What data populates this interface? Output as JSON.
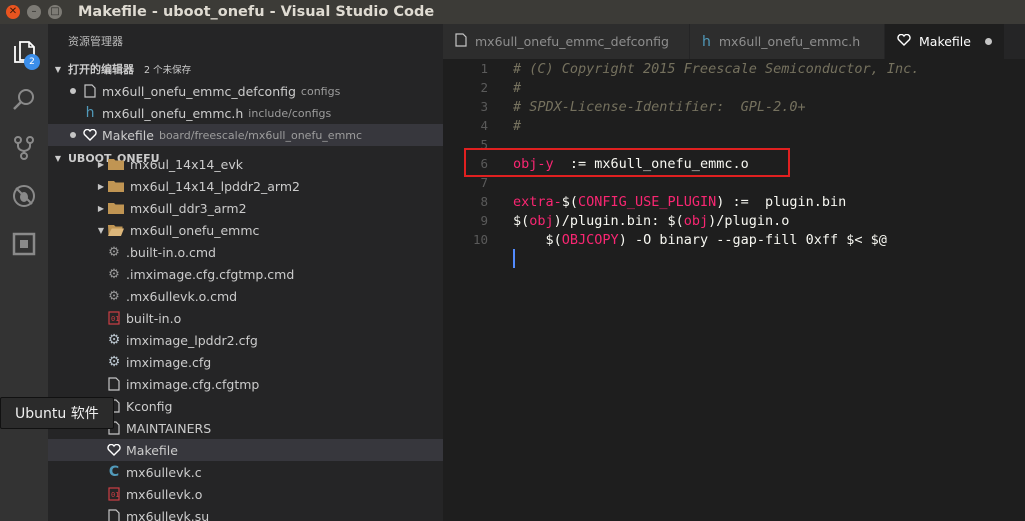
{
  "window": {
    "title": "Makefile - uboot_onefu - Visual Studio Code"
  },
  "activity_bar": {
    "explorer_badge": "2"
  },
  "sidebar": {
    "header": "资源管理器",
    "open_editors": {
      "title": "打开的编辑器",
      "count": "2 个未保存",
      "items": [
        {
          "name": "mx6ull_onefu_emmc_defconfig",
          "desc": "configs"
        },
        {
          "name": "mx6ull_onefu_emmc.h",
          "desc": "include/configs"
        },
        {
          "name": "Makefile",
          "desc": "board/freescale/mx6ull_onefu_emmc"
        }
      ]
    },
    "project": {
      "title": "UBOOT_ONEFU"
    },
    "tree": [
      {
        "label": "mx6ul_14x14_evk"
      },
      {
        "label": "mx6ul_14x14_lpddr2_arm2"
      },
      {
        "label": "mx6ull_ddr3_arm2"
      },
      {
        "label": "mx6ull_onefu_emmc"
      },
      {
        "label": ".built-in.o.cmd"
      },
      {
        "label": ".imximage.cfg.cfgtmp.cmd"
      },
      {
        "label": ".mx6ullevk.o.cmd"
      },
      {
        "label": "built-in.o"
      },
      {
        "label": "imximage_lpddr2.cfg"
      },
      {
        "label": "imximage.cfg"
      },
      {
        "label": "imximage.cfg.cfgtmp"
      },
      {
        "label": "Kconfig"
      },
      {
        "label": "MAINTAINERS"
      },
      {
        "label": "Makefile"
      },
      {
        "label": "mx6ullevk.c"
      },
      {
        "label": "mx6ullevk.o"
      },
      {
        "label": "mx6ullevk.su"
      }
    ]
  },
  "tooltip": "Ubuntu 软件",
  "tabs": [
    {
      "label": "mx6ull_onefu_emmc_defconfig"
    },
    {
      "label": "mx6ull_onefu_emmc.h"
    },
    {
      "label": "Makefile"
    }
  ],
  "code": {
    "line_numbers": [
      "1",
      "2",
      "3",
      "4",
      "5",
      "6",
      "7",
      "8",
      "9",
      "10"
    ],
    "l1": "# (C) Copyright 2015 Freescale Semiconductor, Inc.",
    "l2": "#",
    "l3": "# SPDX-License-Identifier:  GPL-2.0+",
    "l4": "#",
    "l6a": "obj-y",
    "l6b": "  := mx6ull_onefu_emmc.o",
    "l8a": "extra-",
    "l8b": "$(",
    "l8c": "CONFIG_USE_PLUGIN",
    "l8d": ") :=  plugin.bin",
    "l9a": "$(",
    "l9b": "obj",
    "l9c": ")/plugin.bin: ",
    "l9d": "$(",
    "l9e": "obj",
    "l9f": ")/plugin.o",
    "l10a": "    $(",
    "l10b": "OBJCOPY",
    "l10c": ") -O binary --gap-fill 0xff $< $@"
  }
}
